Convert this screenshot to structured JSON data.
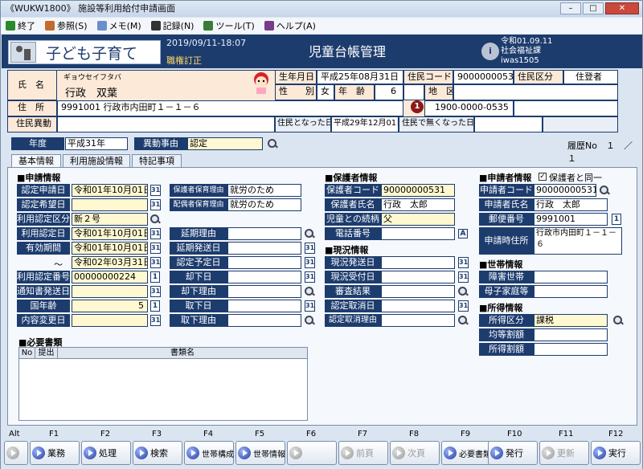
{
  "window": {
    "title": "《WUKW1800》 施設等利用給付申請画面"
  },
  "menu": [
    {
      "label": "終了"
    },
    {
      "label": "参照(S)"
    },
    {
      "label": "メモ(M)"
    },
    {
      "label": "記録(N)"
    },
    {
      "label": "ツール(T)"
    },
    {
      "label": "ヘルプ(A)"
    }
  ],
  "header": {
    "logo": "子ども子育て",
    "datetime": "2019/09/11-18:07",
    "role": "職権訂正",
    "title": "児童台帳管理",
    "version": "令和01.09.11",
    "dept": "社会福祉課",
    "user": "iwas1505"
  },
  "person": {
    "name_label": "氏　名",
    "kana": "ギョウセイフタバ",
    "name": "行政　双葉",
    "dob_label": "生年月日",
    "dob": "平成25年08月31日",
    "resident_code_label": "住民コード",
    "resident_code": "90000000535",
    "resident_type_label": "住民区分",
    "resident_type": "住登者",
    "sex_label": "性　　別",
    "sex": "女",
    "age_label": "年　齢",
    "age": "6",
    "district_label": "地　区",
    "district": "",
    "address_label": "住　所",
    "address": "9991001 行政市内田町１－１－６",
    "phone": "1900-0000-0535",
    "change_label": "住民異動",
    "became_label": "住民となった日",
    "became": "平成29年12月01日",
    "ceased_label": "住民で無くなった日",
    "ceased": ""
  },
  "filter": {
    "year_label": "年度",
    "year": "平成31年",
    "reason_label": "異動事由",
    "reason": "認定",
    "history": "履歴No　１　／　１"
  },
  "tabs": [
    "基本情報",
    "利用施設情報",
    "特記事項"
  ],
  "apply": {
    "section": "■申請情報",
    "date_label": "認定申請日",
    "date": "令和01年10月01日",
    "hope_label": "認定希望日",
    "hope": "",
    "class_label": "利用認定区分",
    "class": "新２号",
    "auth_label": "利用認定日",
    "auth": "令和01年10月01日",
    "valid_label": "有効期間",
    "valid_from": "令和01年10月01日",
    "tilde": "～",
    "valid_to": "令和02年03月31日",
    "num_label": "利用認定番号",
    "num": "00000000224",
    "notice_label": "通知書発送日",
    "notice": "",
    "age_label": "国年齢",
    "age": "5",
    "change_label": "内容変更日",
    "change": ""
  },
  "reason": {
    "guardian_label": "保護者保育理由",
    "guardian": "就労のため",
    "spouse_label": "配偶者保育理由",
    "spouse": "就労のため",
    "ext_label": "延期理由",
    "ext_send_label": "延期発送日",
    "plan_label": "認定予定日",
    "reject_label": "却下日",
    "reject_reason_label": "却下理由",
    "withdraw_label": "取下日",
    "withdraw_reason_label": "取下理由"
  },
  "guardian": {
    "section": "■保護者情報",
    "code_label": "保護者コード",
    "code": "90000000531",
    "name_label": "保護者氏名",
    "name": "行政　太郎",
    "rel_label": "児童との続柄",
    "rel": "父",
    "phone_label": "電話番号",
    "phone": ""
  },
  "status": {
    "section": "■現況情報",
    "send_label": "現況発送日",
    "recv_label": "現況受付日",
    "result_label": "審査結果",
    "cancel_label": "認定取消日",
    "cancel_reason_label": "認定取消理由"
  },
  "applicant": {
    "section": "■申請者情報",
    "same_label": "保護者と同一",
    "same_checked": "✓",
    "code_label": "申請者コード",
    "code": "90000000531",
    "name_label": "申請者氏名",
    "name": "行政　太郎",
    "zip_label": "郵便番号",
    "zip": "9991001",
    "addr_label": "申請時住所",
    "addr": "行政市内田町１－１－６"
  },
  "household": {
    "section": "■世帯情報",
    "disabled_label": "障害世帯",
    "single_label": "母子家庭等"
  },
  "income": {
    "section": "■所得情報",
    "class_label": "所得区分",
    "class": "課税",
    "equal_label": "均等割額",
    "income_label": "所得割額"
  },
  "docs": {
    "section": "■必要書類",
    "col_no": "No",
    "col_sub": "提出",
    "col_name": "書類名"
  },
  "fkeys": {
    "labels": [
      "Alt",
      "F1",
      "F2",
      "F3",
      "F4",
      "F5",
      "F6",
      "F7",
      "F8",
      "F9",
      "F10",
      "F11",
      "F12"
    ],
    "buttons": [
      "業務",
      "処理",
      "検索",
      "世帯構成",
      "世帯情報",
      "",
      "前頁",
      "次頁",
      "必要書類",
      "発行",
      "更新",
      "実行"
    ]
  }
}
